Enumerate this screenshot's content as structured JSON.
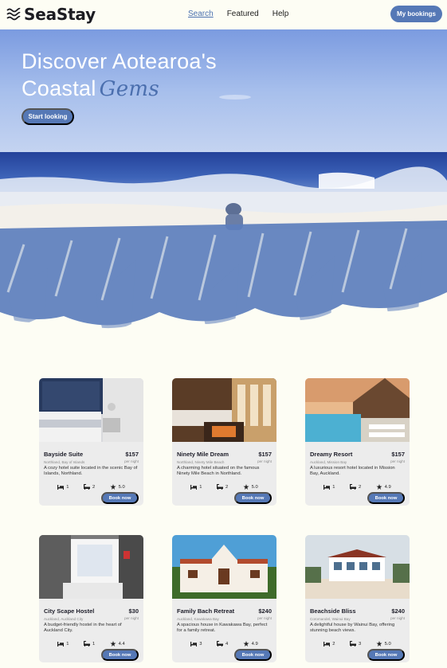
{
  "header": {
    "logo": "SeaStay",
    "nav": [
      {
        "label": "Search",
        "active": true
      },
      {
        "label": "Featured",
        "active": false
      },
      {
        "label": "Help",
        "active": false
      }
    ],
    "bookings_label": "My bookings"
  },
  "hero": {
    "title_line1": "Discover Aotearoa's",
    "title_line2": "Coastal",
    "title_script": "Gems",
    "cta_label": "Start looking"
  },
  "listings": [
    {
      "name": "Bayside Suite",
      "price": "$157",
      "per": "per night",
      "location": "Northland, Bay of Islands",
      "description": "A cozy hotel suite located in the scenic Bay of Islands, Northland.",
      "beds": "1",
      "baths": "2",
      "rating": "5.0",
      "cta": "Book now"
    },
    {
      "name": "Ninety Mile Dream",
      "price": "$157",
      "per": "per night",
      "location": "Northland, Ninety Mile Beach",
      "description": "A charming hotel situated on the famous Ninety Mile Beach in Northland.",
      "beds": "1",
      "baths": "2",
      "rating": "5.0",
      "cta": "Book now"
    },
    {
      "name": "Dreamy Resort",
      "price": "$157",
      "per": "per night",
      "location": "Auckland, Mission Bay",
      "description": "A luxurious resort hotel located in Mission Bay, Auckland.",
      "beds": "1",
      "baths": "2",
      "rating": "4.9",
      "cta": "Book now"
    },
    {
      "name": "City Scape Hostel",
      "price": "$30",
      "per": "per night",
      "location": "Auckland, Auckland City",
      "description": "A budget-friendly hostel in the heart of Auckland City.",
      "beds": "1",
      "baths": "1",
      "rating": "4.4",
      "cta": "Book now"
    },
    {
      "name": "Family Bach Retreat",
      "price": "$240",
      "per": "per night",
      "location": "Auckland, Kawakawa Bay",
      "description": "A spacious house in Kawakawa Bay, perfect for a family retreat.",
      "beds": "3",
      "baths": "4",
      "rating": "4.9",
      "cta": "Book now"
    },
    {
      "name": "Beachside Bliss",
      "price": "$240",
      "per": "per night",
      "location": "Coromandel, Wainui Bay",
      "description": "A delightful house by Wainui Bay, offering stunning beach views.",
      "beds": "2",
      "baths": "3",
      "rating": "5.0",
      "cta": "Book now"
    }
  ],
  "colors": {
    "accent": "#5578b6",
    "background": "#fdfdf4",
    "card": "#ececec"
  },
  "icons": [
    "logo-waves-icon",
    "bed-icon",
    "bath-icon",
    "star-icon"
  ]
}
